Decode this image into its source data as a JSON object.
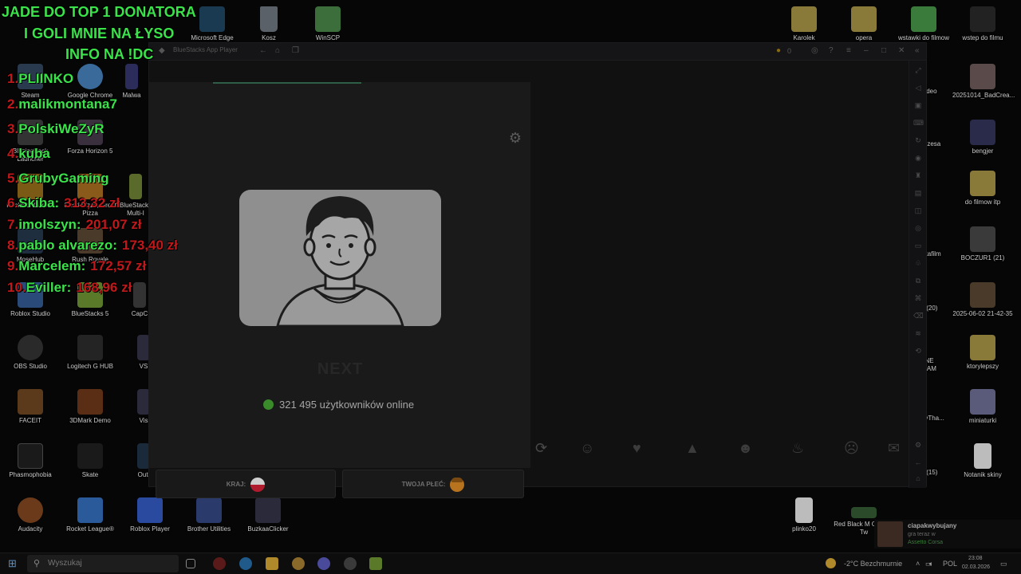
{
  "overlay": {
    "headline": [
      "JADE DO TOP 1 DONATORA",
      "I GOLI MNIE NA ŁYSO",
      "INFO NA !DC"
    ],
    "ranking": [
      {
        "num": "1.",
        "name": "PLIINKO",
        "amount": ""
      },
      {
        "num": "2.",
        "name": "malikmontana7",
        "amount": ""
      },
      {
        "num": "3.",
        "name": "PolskiWeZyR",
        "amount": ""
      },
      {
        "num": "4.",
        "name": "kuba",
        "amount": ""
      },
      {
        "num": "5.",
        "name": "GrubyGaming",
        "amount": ""
      },
      {
        "num": "6.",
        "name": "Skiba:",
        "amount": "313,32 zł"
      },
      {
        "num": "7.",
        "name": "imolszyn:",
        "amount": "201,07 zł"
      },
      {
        "num": "8.",
        "name": "pablo alvarezo:",
        "amount": "173,40 zł"
      },
      {
        "num": "9.",
        "name": "Marcelem:",
        "amount": "172,57 zł"
      },
      {
        "num": "10.",
        "name": "Eviller:",
        "amount": "168,96 zł"
      }
    ]
  },
  "desktop": {
    "left_icons": [
      "Steam",
      "Google Chrome",
      "Malwa",
      "BlazingPack Launcher",
      "Forza Horizon 5",
      "Rockstar Games",
      "Good Pizza, Great Pizza",
      "BlueStacks Multi-I",
      "MoseHub",
      "Rush Royale",
      "Roblox Studio",
      "BlueStacks 5",
      "CapC",
      "OBS Studio",
      "Logitech G HUB",
      "VS",
      "FACEIT",
      "3DMark Demo",
      "Vis",
      "Phasmophobia",
      "Skate",
      "Outl",
      "Audacity",
      "Rocket League®",
      "Roblox Player",
      "Brother Utilities",
      "BuzkaaClicker"
    ],
    "top_icons": [
      "Microsoft Edge",
      "Kosz",
      "WinSCP"
    ],
    "right_icons": [
      "Karolek",
      "opera",
      "wstawki do filmow",
      "wstep do filmu",
      "video",
      "20251014_BadCrea...",
      "prezesa",
      "bengjer",
      "do filmow itp",
      "cokafilm",
      "BOCZUR1 (21)",
      "1 (20)",
      "2025-06-02 21-42-35",
      "NE RAM",
      "ktorylepszy",
      "DilyTha...",
      "miniaturki",
      "1 (15)",
      "Notanik skiny",
      "plinko20",
      "Red Black M Gaming Tw"
    ]
  },
  "bluestacks": {
    "title": "BlueStacks App Player",
    "coins": "0"
  },
  "app": {
    "next_label": "NEXT",
    "online_count": "321 495 użytkowników online",
    "country_label": "KRAJ:",
    "gender_label": "TWOJA PŁEĆ:"
  },
  "reactions": [
    "refresh-icon",
    "smile-icon",
    "heart-icon",
    "thumbs-up-icon",
    "grin-icon",
    "fire-icon",
    "angry-icon",
    "chat-icon"
  ],
  "taskbar": {
    "search_placeholder": "Wyszukaj",
    "weather": "-2°C  Bezchmurnie",
    "lang": "POL",
    "time": "23:08",
    "date": "02.03.2026"
  },
  "toast": {
    "user": "ciapakwybujany",
    "sub": "gra teraz w",
    "game": "Assetto Corsa"
  },
  "colors": {
    "overlay_green": "#3be34a",
    "overlay_red": "#c0181b",
    "online_dot": "#3a8b2a"
  }
}
